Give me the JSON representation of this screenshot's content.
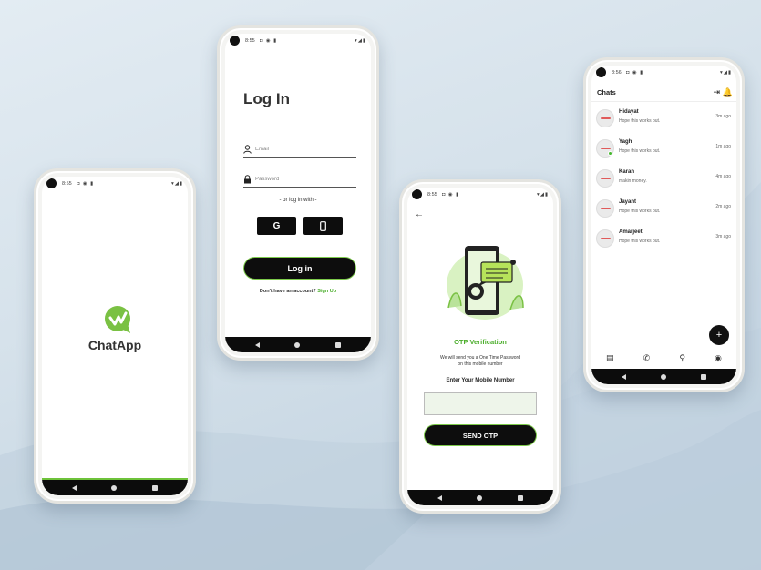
{
  "splash": {
    "status_time": "8:55",
    "app_name": "ChatApp"
  },
  "login": {
    "status_time": "8:55",
    "title": "Log In",
    "email_placeholder": "Email",
    "password_placeholder": "Password",
    "or_text": "- or log in with -",
    "google_label": "G",
    "login_button": "Log in",
    "signup_prompt": "Don't have an account?",
    "signup_link": "Sign Up"
  },
  "otp": {
    "status_time": "8:55",
    "title": "OTP Verification",
    "description_line1": "We will send you a One Time Password",
    "description_line2": "on this mobile number",
    "input_label": "Enter Your Mobile Number",
    "send_button": "SEND OTP"
  },
  "chats": {
    "status_time": "8:56",
    "title": "Chats",
    "items": [
      {
        "name": "Hidayat",
        "message": "Hope this works out.",
        "time": "3m ago"
      },
      {
        "name": "Yagh",
        "message": "Hope this works out.",
        "time": "1m ago"
      },
      {
        "name": "Karan",
        "message": "makin money.",
        "time": "4m ago"
      },
      {
        "name": "Jayant",
        "message": "Hope this works out.",
        "time": "2m ago"
      },
      {
        "name": "Amarjeet",
        "message": "Hope this works out.",
        "time": "3m ago"
      }
    ],
    "fab_label": "+"
  },
  "colors": {
    "accent_green": "#4cae2c",
    "button_black": "#0d0d0d"
  }
}
